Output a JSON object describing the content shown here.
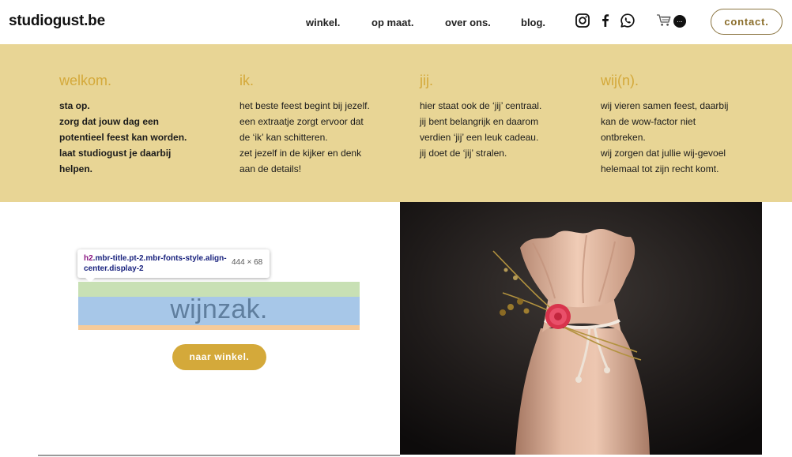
{
  "header": {
    "logo": "studiogust.be",
    "nav": [
      "winkel.",
      "op maat.",
      "over ons.",
      "blog."
    ],
    "social_icons": [
      "instagram-icon",
      "facebook-icon",
      "whatsapp-icon"
    ],
    "cart_icon": "cart-icon",
    "cart_badge": "...",
    "contact_label": "contact."
  },
  "intro": {
    "columns": [
      {
        "title": "welkom.",
        "text": "sta op.\nzorg dat jouw dag een\npotentieel feest kan worden.\nlaat studiogust je daarbij\nhelpen."
      },
      {
        "title": "ik.",
        "text": "het beste feest begint bij jezelf.\neen extraatje zorgt ervoor dat\nde ‘ik’ kan schitteren.\nzet jezelf in de kijker en denk\naan de details!"
      },
      {
        "title": "jij.",
        "text": "hier staat ook de ‘jij’ centraal.\njij bent belangrijk en daarom\nverdien ‘jij’ een leuk cadeau.\njij doet de ‘jij’ stralen."
      },
      {
        "title": "wij(n).",
        "text": "wij vieren samen feest, daarbij\nkan de wow-factor niet\nontbreken.\nwij zorgen dat jullie wij-gevoel\nhelemaal tot zijn recht komt."
      }
    ]
  },
  "devtools": {
    "tag": "h2",
    "selector": ".mbr-title.pt-2.mbr-fonts-style.align-center.display-2",
    "size": "444 × 68"
  },
  "product": {
    "title": "wijnzak.",
    "button_label": "naar winkel."
  },
  "colors": {
    "accent": "#d4a93a",
    "band": "#e8d595",
    "highlight_content": "#a7c7e8",
    "highlight_margin": "#c8e0b4",
    "highlight_padding": "#f6cb9a"
  }
}
